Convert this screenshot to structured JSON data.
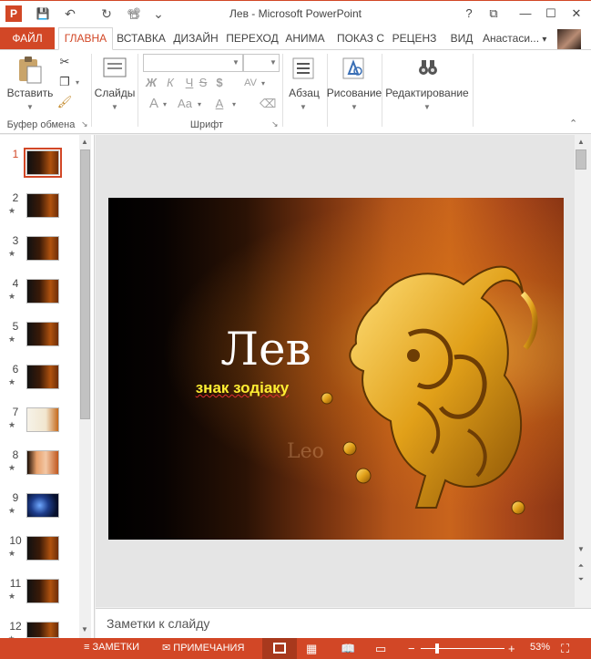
{
  "window": {
    "title": "Лев - Microsoft PowerPoint",
    "help": "?",
    "restore_ribbon": "⧉",
    "minimize": "—",
    "maximize": "☐",
    "close": "✕"
  },
  "quick_access": {
    "app": "P",
    "save": "💾",
    "undo": "↶",
    "redo": "↻",
    "present": "📽",
    "more": "⌄"
  },
  "tabs": [
    {
      "label": "ФАЙЛ"
    },
    {
      "label": "ГЛАВНА"
    },
    {
      "label": "ВСТАВКА"
    },
    {
      "label": "ДИЗАЙН"
    },
    {
      "label": "ПЕРЕХОД"
    },
    {
      "label": "АНИМА"
    },
    {
      "label": "ПОКАЗ С"
    },
    {
      "label": "РЕЦЕНЗ"
    },
    {
      "label": "ВИД"
    }
  ],
  "user": {
    "name": "Анастаси...",
    "dropdown": "▾"
  },
  "ribbon": {
    "paste_label": "Вставить",
    "clipboard_group": "Буфер обмена",
    "slides_label": "Слайды",
    "font_group": "Шрифт",
    "bold": "Ж",
    "italic": "К",
    "underline": "Ч",
    "strike": "S",
    "shadow": "$",
    "spacing": "AV",
    "grow": "A",
    "case": "Aa",
    "color": "A",
    "clear": "⌫",
    "paragraph_label": "Абзац",
    "drawing_label": "Рисование",
    "editing_label": "Редактирование",
    "collapse": "⌃",
    "launcher": "↘"
  },
  "slides": [
    {
      "num": "1",
      "star": ""
    },
    {
      "num": "2",
      "star": "★"
    },
    {
      "num": "3",
      "star": "★"
    },
    {
      "num": "4",
      "star": "★"
    },
    {
      "num": "5",
      "star": "★"
    },
    {
      "num": "6",
      "star": "★"
    },
    {
      "num": "7",
      "star": "★"
    },
    {
      "num": "8",
      "star": "★"
    },
    {
      "num": "9",
      "star": "★"
    },
    {
      "num": "10",
      "star": "★"
    },
    {
      "num": "11",
      "star": "★"
    },
    {
      "num": "12",
      "star": "★"
    }
  ],
  "slide": {
    "title": "Лев",
    "subtitle": "знак зодіаку",
    "watermark": "Leo"
  },
  "notes": {
    "placeholder": "Заметки к слайду"
  },
  "status": {
    "notes": "ЗАМЕТКИ",
    "comments": "ПРИМЕЧАНИЯ",
    "zoom": "53%",
    "zoom_out": "−",
    "zoom_in": "+"
  },
  "colors": {
    "accent": "#d24726",
    "subtitle": "#ffee33"
  }
}
